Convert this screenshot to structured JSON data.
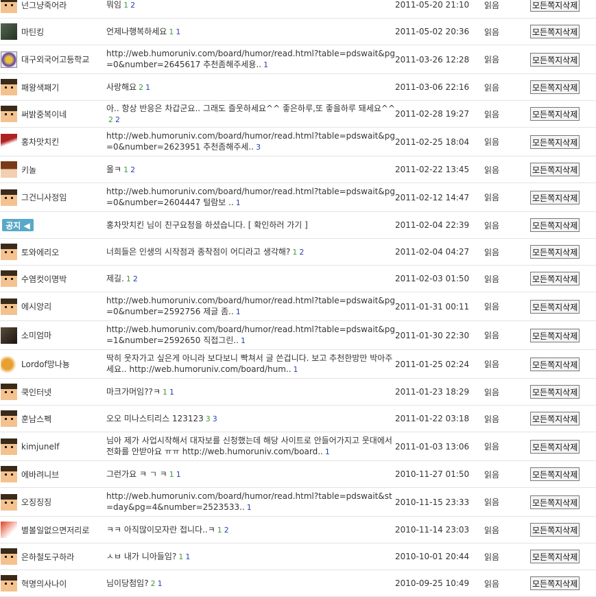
{
  "delete_label": "모든쪽지삭제",
  "notice_label": "공지",
  "rows": [
    {
      "sender": "넌그냥죽어라",
      "avatar": "pixel-face",
      "message": "뭐임",
      "c1": "1",
      "c2": "2",
      "date": "2011-05-20 21:10",
      "status": "읽음"
    },
    {
      "sender": "마틴킹",
      "avatar": "photo",
      "message": "언제나행복하세요",
      "c1": "1",
      "c2": "1",
      "date": "2011-05-02 20:36",
      "status": "읽음"
    },
    {
      "sender": "대구외국어고등학교",
      "avatar": "school-emblem",
      "message": "http://web.humoruniv.com/board/humor/read.html?table=pdswait&pg=0&number=2645617 추천좀해주세용..",
      "c1": "",
      "c2": "1",
      "date": "2011-03-26 12:28",
      "status": "읽음"
    },
    {
      "sender": "패왕색패기",
      "avatar": "pixel-face",
      "message": "사랑해요",
      "c1": "2",
      "c2": "1",
      "date": "2011-03-06 22:16",
      "status": "읽음"
    },
    {
      "sender": "써밝중복이네",
      "avatar": "pixel-face",
      "message": "아.. 항상 반응은 차갑군요.. 그래도 즐웃하세요^^ 좋은하루,또 좋을하루 돼세요^^",
      "c1": "2",
      "c2": "2",
      "date": "2011-02-28 19:27",
      "status": "읽음"
    },
    {
      "sender": "홍차맛치킨",
      "avatar": "bird",
      "message": "http://web.humoruniv.com/board/humor/read.html?table=pdswait&pg=0&number=2623951 추천좀해주세..",
      "c1": "",
      "c2": "3",
      "date": "2011-02-25 18:04",
      "status": "읽음"
    },
    {
      "sender": "키놀",
      "avatar": "anime",
      "message": "올ㅋ",
      "c1": "1",
      "c2": "2",
      "date": "2011-02-22 13:45",
      "status": "읽음"
    },
    {
      "sender": "그건니사정임",
      "avatar": "pixel-face",
      "message": "http://web.humoruniv.com/board/humor/read.html?table=pdswait&pg=0&number=2604447 털람보 ..",
      "c1": "",
      "c2": "1",
      "date": "2011-02-12 14:47",
      "status": "읽음"
    },
    {
      "sender": "",
      "avatar": "notice",
      "message": "홍차맛치킨 님이 친구요청을 하셨습니다. [ 확인하러 가기 ]",
      "c1": "",
      "c2": "",
      "date": "2011-02-04 22:39",
      "status": "읽음"
    },
    {
      "sender": "토와에리오",
      "avatar": "pixel-face",
      "message": "너희들은 인생의 시작점과 종착점이 어디라고 생각해?",
      "c1": "1",
      "c2": "2",
      "date": "2011-02-04 04:27",
      "status": "읽음"
    },
    {
      "sender": "수염컷이명박",
      "avatar": "pixel-face",
      "message": "제길.",
      "c1": "1",
      "c2": "2",
      "date": "2011-02-03 01:50",
      "status": "읽음"
    },
    {
      "sender": "에시앙리",
      "avatar": "pixel-face",
      "message": "http://web.humoruniv.com/board/humor/read.html?table=pdswait&pg=0&number=2592756 제글 좀..",
      "c1": "",
      "c2": "1",
      "date": "2011-01-31 00:11",
      "status": "읽음"
    },
    {
      "sender": "소미엄마",
      "avatar": "dark-photo",
      "message": "http://web.humoruniv.com/board/humor/read.html?table=pdswait&pg=1&number=2592650 직접그린..",
      "c1": "",
      "c2": "1",
      "date": "2011-01-30 22:30",
      "status": "읽음"
    },
    {
      "sender": "Lordof망나뇽",
      "avatar": "dragon",
      "message": "딱히 웃자가고 싶은게 아니라 보다보니 빡쳐서 글 쓴겁니다. 보고 추천한방만 박아주세요.. http://web.humoruniv.com/board/hum..",
      "c1": "",
      "c2": "1",
      "date": "2011-01-25 02:24",
      "status": "읽음"
    },
    {
      "sender": "쿡인터넷",
      "avatar": "pixel-face",
      "message": "마크가머임??ㅋ",
      "c1": "1",
      "c2": "1",
      "date": "2011-01-23 18:29",
      "status": "읽음"
    },
    {
      "sender": "훈남스펙",
      "avatar": "pixel-face",
      "message": "오오 미나스티리스 123123",
      "c1": "3",
      "c2": "3",
      "date": "2011-01-22 03:18",
      "status": "읽음"
    },
    {
      "sender": "kimjunelf",
      "avatar": "pixel-face",
      "message": "님아 제가 사업시작해서 대자보를 신청했는데 해당 사이트로 안들어가지고 웃대에서 전화를 안받아요 ㅠㅠ http://web.humoruniv.com/board..",
      "c1": "",
      "c2": "1",
      "date": "2011-01-03 13:06",
      "status": "읽음"
    },
    {
      "sender": "에바려니브",
      "avatar": "pixel-face",
      "message": "그런가요 ㅋ ㄱ ㅋ",
      "c1": "1",
      "c2": "1",
      "date": "2010-11-27 01:50",
      "status": "읽음"
    },
    {
      "sender": "오징징징",
      "avatar": "pixel-face",
      "message": "http://web.humoruniv.com/board/humor/read.html?table=pdswait&st=day&pg=4&number=2523533..",
      "c1": "",
      "c2": "1",
      "date": "2010-11-15 23:33",
      "status": "읽음"
    },
    {
      "sender": "별볼일없으면저리로",
      "avatar": "red-character",
      "message": "ㅋㅋ 아직많이모자란 접니다..ㅋ",
      "c1": "1",
      "c2": "2",
      "date": "2010-11-14 23:03",
      "status": "읽음"
    },
    {
      "sender": "은하철도구하라",
      "avatar": "pixel-face",
      "message": "ㅅㅂ 내가 니아들임?",
      "c1": "1",
      "c2": "1",
      "date": "2010-10-01 20:44",
      "status": "읽음"
    },
    {
      "sender": "혁명의사나이",
      "avatar": "pixel-face",
      "message": "님이당첨임?",
      "c1": "2",
      "c2": "1",
      "date": "2010-09-25 10:49",
      "status": "읽음"
    }
  ]
}
